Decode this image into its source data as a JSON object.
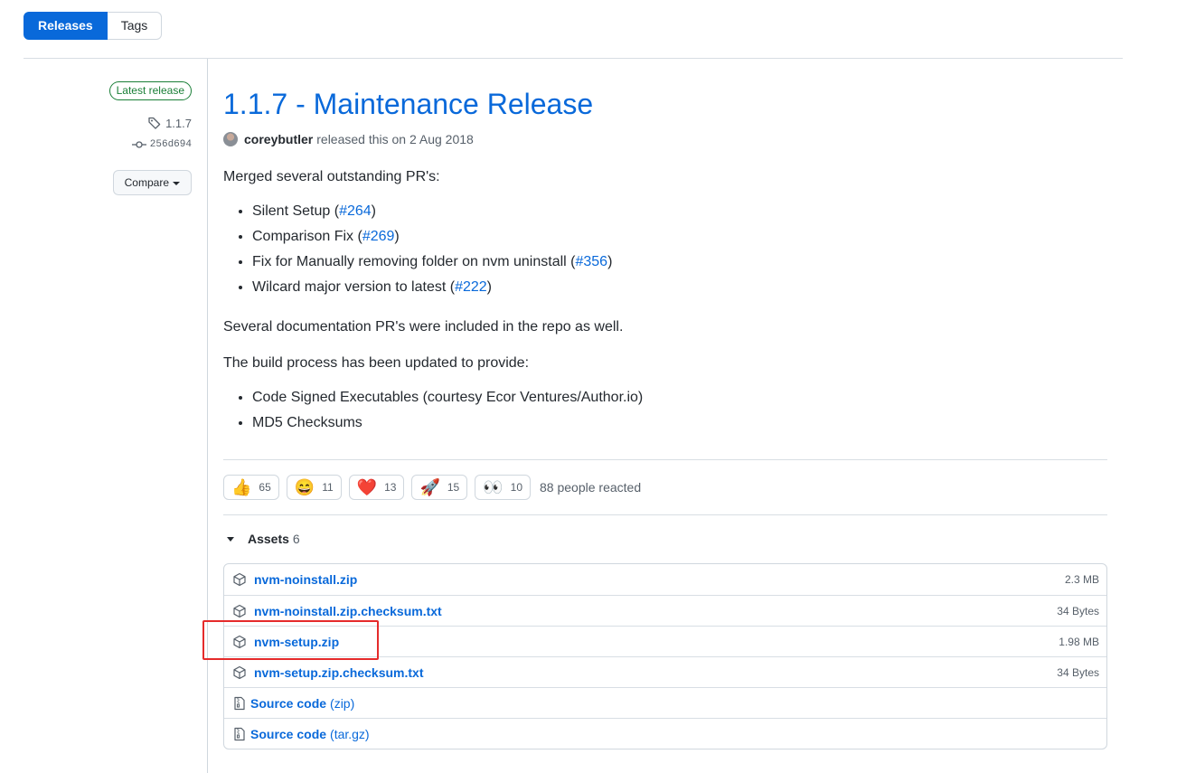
{
  "subnav": {
    "releases": "Releases",
    "tags": "Tags"
  },
  "sidebar": {
    "latest_badge": "Latest release",
    "tag": "1.1.7",
    "commit": "256d694",
    "compare": "Compare"
  },
  "release": {
    "title": "1.1.7 - Maintenance Release",
    "author": "coreybutler",
    "released_text": "released this on 2 Aug 2018"
  },
  "body": {
    "intro": "Merged several outstanding PR's:",
    "prs": [
      {
        "text": "Silent Setup",
        "ref": "#264"
      },
      {
        "text": "Comparison Fix",
        "ref": "#269"
      },
      {
        "text": "Fix for Manually removing folder on nvm uninstall",
        "ref": "#356"
      },
      {
        "text": "Wilcard major version to latest",
        "ref": "#222"
      }
    ],
    "docs_note": "Several documentation PR's were included in the repo as well.",
    "build_intro": "The build process has been updated to provide:",
    "build_items": [
      "Code Signed Executables (courtesy Ecor Ventures/Author.io)",
      "MD5 Checksums"
    ]
  },
  "reactions": {
    "items": [
      {
        "icon": "thumbs-up-icon",
        "emoji": "👍",
        "count": "65"
      },
      {
        "icon": "laugh-icon",
        "emoji": "😄",
        "count": "11"
      },
      {
        "icon": "heart-icon",
        "emoji": "❤️",
        "count": "13"
      },
      {
        "icon": "rocket-icon",
        "emoji": "🚀",
        "count": "15"
      },
      {
        "icon": "eyes-icon",
        "emoji": "👀",
        "count": "10"
      }
    ],
    "summary": "88 people reacted"
  },
  "assets": {
    "label": "Assets",
    "count": "6",
    "files": [
      {
        "name": "nvm-noinstall.zip",
        "suffix": "",
        "size": "2.3 MB",
        "icon": "package-icon"
      },
      {
        "name": "nvm-noinstall.zip.checksum.txt",
        "suffix": "",
        "size": "34 Bytes",
        "icon": "package-icon"
      },
      {
        "name": "nvm-setup.zip",
        "suffix": "",
        "size": "1.98 MB",
        "icon": "package-icon"
      },
      {
        "name": "nvm-setup.zip.checksum.txt",
        "suffix": "",
        "size": "34 Bytes",
        "icon": "package-icon"
      },
      {
        "name": "Source code",
        "suffix": "(zip)",
        "size": "",
        "icon": "file-zip-icon"
      },
      {
        "name": "Source code",
        "suffix": "(tar.gz)",
        "size": "",
        "icon": "file-zip-icon"
      }
    ]
  },
  "colors": {
    "accent": "#0969da",
    "success": "#1a7f37",
    "highlight": "#e52b2b"
  }
}
